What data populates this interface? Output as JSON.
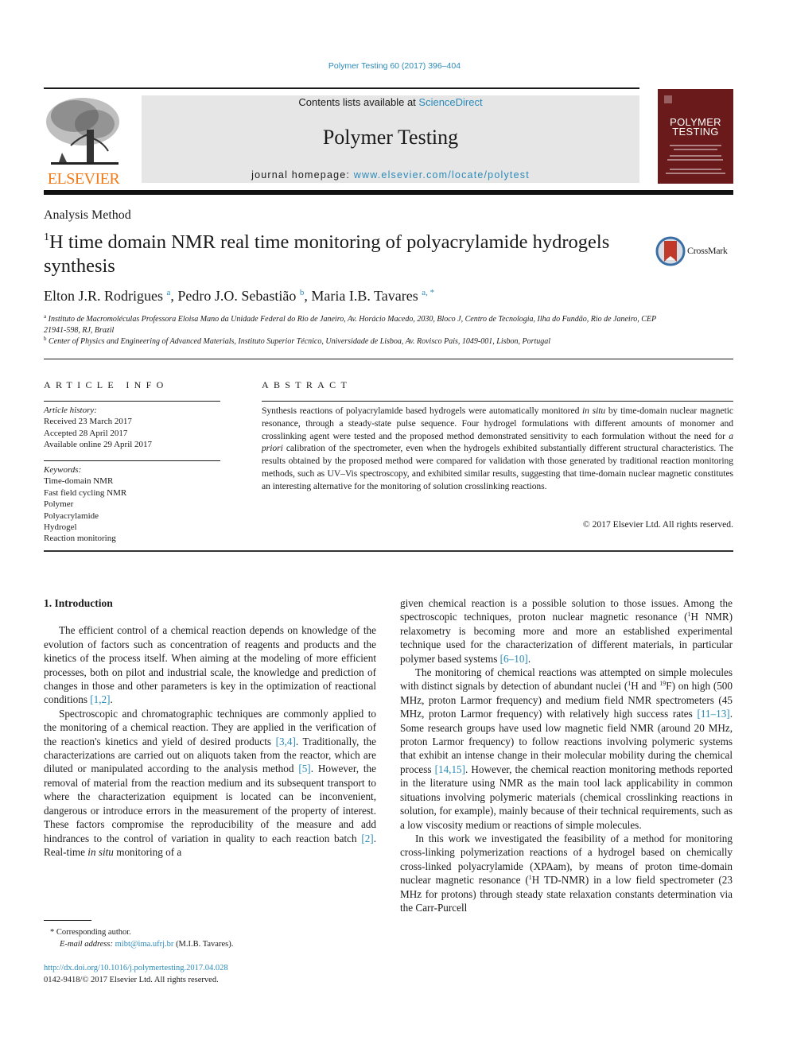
{
  "running_header": "Polymer Testing 60 (2017) 396–404",
  "masthead": {
    "publisher": "ELSEVIER",
    "contents_prefix": "Contents lists available at ",
    "contents_link": "ScienceDirect",
    "journal_name": "Polymer Testing",
    "homepage_prefix": "journal homepage: ",
    "homepage_link": "www.elsevier.com/locate/polytest",
    "cover_title": "POLYMER\nTESTING",
    "colors": {
      "link": "#2a8ab8",
      "elsevier_orange": "#f07b1a",
      "cover": "#6a1a1a",
      "masthead_bg": "#e6e6e6"
    }
  },
  "article": {
    "type": "Analysis Method",
    "title_sup": "1",
    "title_rest": "H time domain NMR real time monitoring of polyacrylamide hydrogels synthesis",
    "crossmark_label": "CrossMark",
    "authors": [
      {
        "name": "Elton J.R. Rodrigues",
        "marks": "a"
      },
      {
        "name": "Pedro J.O. Sebastião",
        "marks": "b"
      },
      {
        "name": "Maria I.B. Tavares",
        "marks": "a, *"
      }
    ],
    "author_sep": ", ",
    "affiliations": [
      {
        "mark": "a",
        "text": "Instituto de Macromoléculas Professora Eloisa Mano da Unidade Federal do Rio de Janeiro, Av. Horácio Macedo, 2030, Bloco J, Centro de Tecnologia, Ilha do Fundão, Rio de Janeiro, CEP 21941-598, RJ, Brazil"
      },
      {
        "mark": "b",
        "text": "Center of Physics and Engineering of Advanced Materials, Instituto Superior Técnico, Universidade de Lisboa, Av. Rovisco Pais, 1049-001, Lisbon, Portugal"
      }
    ]
  },
  "article_info": {
    "heading": "ARTICLE INFO",
    "history_label": "Article history:",
    "history": [
      "Received 23 March 2017",
      "Accepted 28 April 2017",
      "Available online 29 April 2017"
    ],
    "keywords_label": "Keywords:",
    "keywords": [
      "Time-domain NMR",
      "Fast field cycling NMR",
      "Polymer",
      "Polyacrylamide",
      "Hydrogel",
      "Reaction monitoring"
    ]
  },
  "abstract": {
    "heading": "ABSTRACT",
    "parts": [
      "Synthesis reactions of polyacrylamide based hydrogels were automatically monitored ",
      "in situ",
      " by time-domain nuclear magnetic resonance, through a steady-state pulse sequence. Four hydrogel formulations with different amounts of monomer and crosslinking agent were tested and the proposed method demonstrated sensitivity to each formulation without the need for ",
      "a priori",
      " calibration of the spectrometer, even when the hydrogels exhibited substantially different structural characteristics. The results obtained by the proposed method were compared for validation with those generated by traditional reaction monitoring methods, such as UV–Vis spectroscopy, and exhibited similar results, suggesting that time-domain nuclear magnetic constitutes an interesting alternative for the monitoring of solution crosslinking reactions."
    ],
    "copyright": "© 2017 Elsevier Ltd. All rights reserved."
  },
  "body": {
    "section_heading": "1.  Introduction",
    "p1": {
      "text": "The efficient control of a chemical reaction depends on knowledge of the evolution of factors such as concentration of reagents and products and the kinetics of the process itself. When aiming at the modeling of more efficient processes, both on pilot and industrial scale, the knowledge and prediction of changes in those and other parameters is key in the optimization of reactional conditions ",
      "ref1": "[1,2]",
      "end": "."
    },
    "p2": {
      "a": "Spectroscopic and chromatographic techniques are commonly applied to the monitoring of a chemical reaction. They are applied in the verification of the reaction's kinetics and yield of desired products ",
      "ref1": "[3,4]",
      "b": ". Traditionally, the characterizations are carried out on aliquots taken from the reactor, which are diluted or manipulated according to the analysis method ",
      "ref2": "[5]",
      "c": ". However, the removal of material from the reaction medium and its subsequent transport to where the characterization equipment is located can be inconvenient, dangerous or introduce errors in the measurement of the property of interest. These factors compromise the reproducibility of the measure and add hindrances to the control of variation in quality to each reaction batch ",
      "ref3": "[2]",
      "d": ". Real-time ",
      "italic": "in situ",
      "e": " monitoring of a"
    },
    "p2_cont": {
      "a": "given chemical reaction is a possible solution to those issues. Among the spectroscopic techniques, proton nuclear magnetic resonance (",
      "sup": "1",
      "b": "H NMR) relaxometry is becoming more and more an established experimental technique used for the characterization of different materials, in particular polymer based systems ",
      "ref": "[6–10]",
      "c": "."
    },
    "p3": {
      "a": "The monitoring of chemical reactions was attempted on simple molecules with distinct signals by detection of abundant nuclei (",
      "sup1": "1",
      "b": "H and ",
      "sup2": "19",
      "c": "F) on high (500 MHz, proton Larmor frequency) and medium field NMR spectrometers (45 MHz, proton Larmor frequency) with relatively high success rates ",
      "ref1": "[11–13]",
      "d": ". Some research groups have used low magnetic field NMR (around 20 MHz, proton Larmor frequency) to follow reactions involving polymeric systems that exhibit an intense change in their molecular mobility during the chemical process ",
      "ref2": "[14,15]",
      "e": ". However, the chemical reaction monitoring methods reported in the literature using NMR as the main tool lack applicability in common situations involving polymeric materials (chemical crosslinking reactions in solution, for example), mainly because of their technical requirements, such as a low viscosity medium or reactions of simple molecules."
    },
    "p4": {
      "a": "In this work we investigated the feasibility of a method for monitoring cross-linking polymerization reactions of a hydrogel based on chemically cross-linked polyacrylamide (XPAam), by means of proton time-domain nuclear magnetic resonance (",
      "sup": "1",
      "b": "H TD-NMR) in a low field spectrometer (23 MHz for protons) through steady state relaxation constants determination via the Carr-Purcell"
    }
  },
  "footnotes": {
    "star": "*",
    "corresponding": "Corresponding author.",
    "email_label": "E-mail address:",
    "email": "mibt@ima.ufrj.br",
    "email_suffix": " (M.I.B. Tavares).",
    "doi": "http://dx.doi.org/10.1016/j.polymertesting.2017.04.028",
    "issn_copyright": "0142-9418/© 2017 Elsevier Ltd. All rights reserved."
  }
}
